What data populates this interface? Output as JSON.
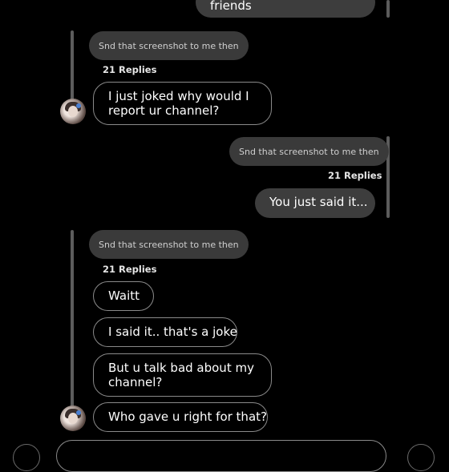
{
  "top_sent_bubble": {
    "text": "friends"
  },
  "threads": [
    {
      "quoted": "Snd that screenshot to me then",
      "replies": "21 Replies",
      "messages": [
        "I just joked why would I report ur channel?"
      ]
    },
    {
      "quoted": "Snd that screenshot to me then",
      "replies": "21 Replies",
      "messages": [
        "You just said it..."
      ]
    },
    {
      "quoted": "Snd that screenshot to me then",
      "replies": "21 Replies",
      "messages": [
        "Waitt",
        "I said it.. that's a joke",
        "But u talk bad about my channel?",
        "Who gave u right for that?"
      ]
    }
  ],
  "icons": {
    "avatar": "profile-avatar-photo"
  },
  "colors": {
    "background": "#000000",
    "outgoing_bubble": "#3d3d3d",
    "quoted_pill": "#3a3a3a",
    "thread_line": "#5c5c5c",
    "incoming_border": "#8a8a8a"
  }
}
